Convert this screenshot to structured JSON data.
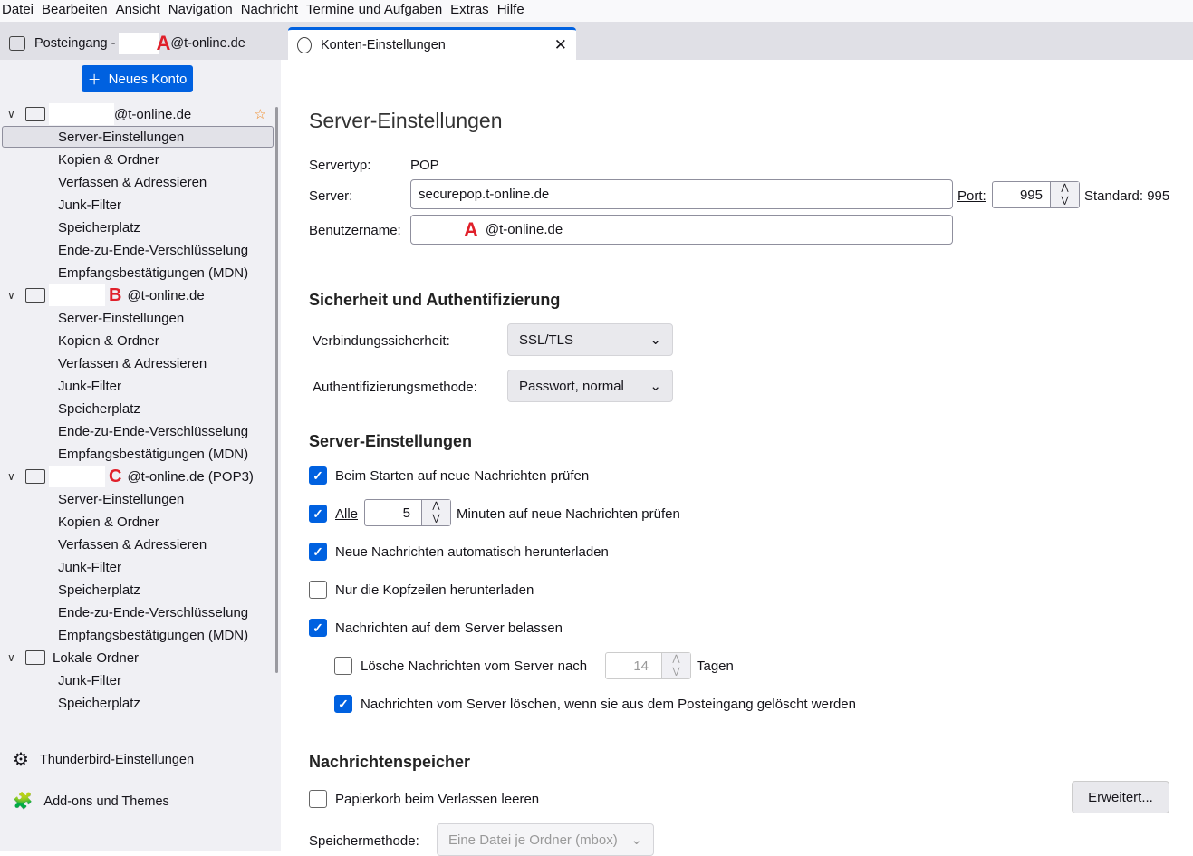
{
  "menu": [
    "Datei",
    "Bearbeiten",
    "Ansicht",
    "Navigation",
    "Nachricht",
    "Termine und Aufgaben",
    "Extras",
    "Hilfe"
  ],
  "tabs": {
    "inbox": "Posteingang -",
    "inbox_marker": "A",
    "inbox_domain": "@t-online.de",
    "settings": "Konten-Einstellungen",
    "close": "✕"
  },
  "sidebar": {
    "new_account": "Neues Konto",
    "accounts": [
      {
        "marker": "",
        "name": "@t-online.de",
        "items": [
          "Server-Einstellungen",
          "Kopien & Ordner",
          "Verfassen & Adressieren",
          "Junk-Filter",
          "Speicherplatz",
          "Ende-zu-Ende-Verschlüsselung",
          "Empfangsbestätigungen (MDN)"
        ]
      },
      {
        "marker": "B",
        "name": "@t-online.de",
        "items": [
          "Server-Einstellungen",
          "Kopien & Ordner",
          "Verfassen & Adressieren",
          "Junk-Filter",
          "Speicherplatz",
          "Ende-zu-Ende-Verschlüsselung",
          "Empfangsbestätigungen (MDN)"
        ]
      },
      {
        "marker": "C",
        "name": "@t-online.de (POP3)",
        "items": [
          "Server-Einstellungen",
          "Kopien & Ordner",
          "Verfassen & Adressieren",
          "Junk-Filter",
          "Speicherplatz",
          "Ende-zu-Ende-Verschlüsselung",
          "Empfangsbestätigungen (MDN)"
        ]
      },
      {
        "marker": "",
        "name": "Lokale Ordner",
        "items": [
          "Junk-Filter",
          "Speicherplatz"
        ]
      }
    ],
    "settings": "Thunderbird-Einstellungen",
    "addons": "Add-ons und Themes"
  },
  "main": {
    "title": "Server-Einstellungen",
    "servertype_label": "Servertyp:",
    "servertype": "POP",
    "server_label": "Server:",
    "server": "securepop.t-online.de",
    "port_label": "Port:",
    "port": "995",
    "standard": "Standard: 995",
    "user_label": "Benutzername:",
    "user_marker": "A",
    "user_domain": "@t-online.de",
    "security_heading": "Sicherheit und Authentifizierung",
    "conn_label": "Verbindungssicherheit:",
    "conn": "SSL/TLS",
    "auth_label": "Authentifizierungsmethode:",
    "auth": "Passwort, normal",
    "server_heading": "Server-Einstellungen",
    "check_start": "Beim Starten auf neue Nachrichten prüfen",
    "every": "Alle",
    "minutes": "5",
    "minutes_label": "Minuten auf neue Nachrichten prüfen",
    "auto_download": "Neue Nachrichten automatisch herunterladen",
    "headers_only": "Nur die Kopfzeilen herunterladen",
    "leave_on_server": "Nachrichten auf dem Server belassen",
    "delete_after": "Lösche Nachrichten vom Server nach",
    "days": "14",
    "days_label": "Tagen",
    "delete_when_removed": "Nachrichten vom Server löschen, wenn sie aus dem Posteingang gelöscht werden",
    "storage_heading": "Nachrichtenspeicher",
    "empty_trash": "Papierkorb beim Verlassen leeren",
    "advanced": "Erweitert...",
    "storage_label": "Speichermethode:",
    "storage": "Eine Datei je Ordner (mbox)"
  }
}
